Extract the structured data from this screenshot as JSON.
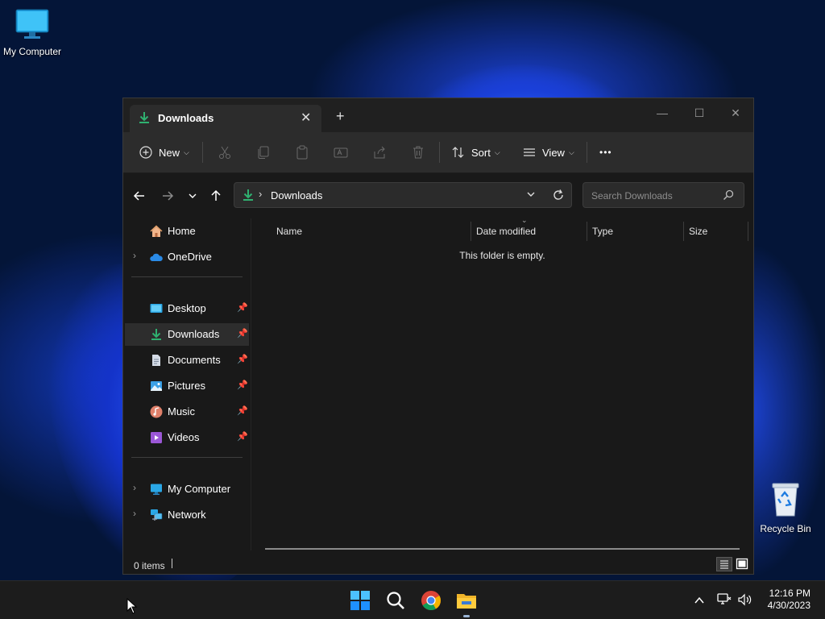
{
  "desktop": {
    "icons": [
      {
        "label": "My Computer"
      },
      {
        "label": "Recycle Bin"
      }
    ]
  },
  "window": {
    "tab_title": "Downloads",
    "new_tab_symbol": "+",
    "close_tab_symbol": "✕",
    "controls": {
      "minimize": "—",
      "maximize": "☐",
      "close": "✕"
    },
    "toolbar": {
      "new_label": "New",
      "sort_label": "Sort",
      "view_label": "View",
      "more_label": "•••",
      "icons": [
        "cut-icon",
        "copy-icon",
        "paste-icon",
        "rename-icon",
        "share-icon",
        "delete-icon"
      ]
    },
    "address": {
      "path": "Downloads",
      "separator": "›"
    },
    "search": {
      "placeholder": "Search Downloads"
    },
    "nav": {
      "quick": [
        {
          "label": "Home",
          "icon": "home-icon",
          "expandable": false
        },
        {
          "label": "OneDrive",
          "icon": "onedrive-icon",
          "expandable": true
        }
      ],
      "pinned": [
        {
          "label": "Desktop",
          "icon": "desktop-folder-icon",
          "pin": true
        },
        {
          "label": "Downloads",
          "icon": "downloads-folder-icon",
          "pin": true,
          "selected": true
        },
        {
          "label": "Documents",
          "icon": "documents-folder-icon",
          "pin": true
        },
        {
          "label": "Pictures",
          "icon": "pictures-folder-icon",
          "pin": true
        },
        {
          "label": "Music",
          "icon": "music-folder-icon",
          "pin": true
        },
        {
          "label": "Videos",
          "icon": "videos-folder-icon",
          "pin": true
        }
      ],
      "devices": [
        {
          "label": "My Computer",
          "icon": "computer-icon",
          "expandable": true
        },
        {
          "label": "Network",
          "icon": "network-icon",
          "expandable": true
        }
      ]
    },
    "columns": [
      "Name",
      "Date modified",
      "Type",
      "Size"
    ],
    "empty_message": "This folder is empty.",
    "status": {
      "items": "0 items"
    }
  },
  "taskbar": {
    "apps": [
      "start-icon",
      "search-icon",
      "chrome-icon",
      "file-explorer-icon"
    ],
    "clock": {
      "time": "12:16 PM",
      "date": "4/30/2023"
    }
  },
  "colors": {
    "accent": "#0078d4",
    "download_green": "#2fb170",
    "window_bg": "#191919",
    "toolbar_bg": "#2c2c2c"
  }
}
